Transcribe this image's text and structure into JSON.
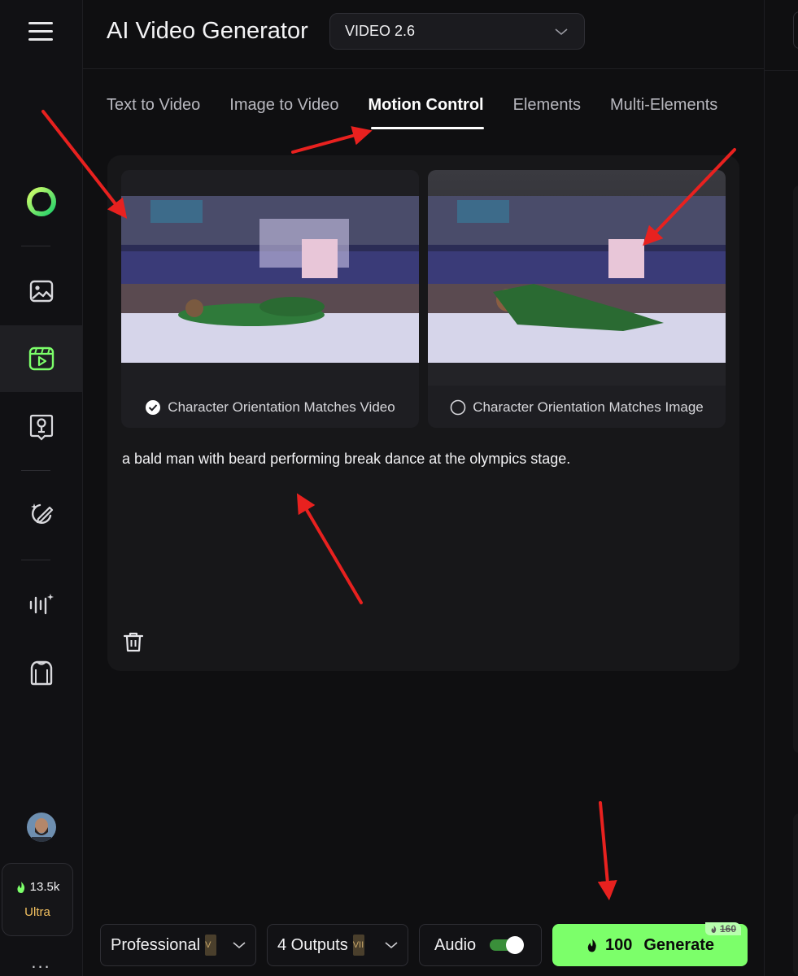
{
  "header": {
    "title": "AI Video Generator",
    "model_select_value": "VIDEO 2.6"
  },
  "tabs": [
    {
      "label": "Text to Video",
      "active": false
    },
    {
      "label": "Image to Video",
      "active": false
    },
    {
      "label": "Motion Control",
      "active": true
    },
    {
      "label": "Elements",
      "active": false
    },
    {
      "label": "Multi-Elements",
      "active": false
    }
  ],
  "sidebar": {
    "items": [
      {
        "icon": "image-icon",
        "active": false
      },
      {
        "icon": "video-icon",
        "active": true
      },
      {
        "icon": "lightbulb-icon",
        "active": false
      },
      {
        "icon": "magic-edit-icon",
        "active": false
      },
      {
        "icon": "audio-wave-icon",
        "active": false
      },
      {
        "icon": "shirt-icon",
        "active": false
      }
    ],
    "credits": "13.5k",
    "tier": "Ultra",
    "more": "..."
  },
  "motion_control": {
    "option_video_label": "Character Orientation Matches Video",
    "option_image_label": "Character Orientation Matches Image",
    "selected_option": "video",
    "prompt": "a bald man with beard performing break dance at the olympics stage."
  },
  "bottom_bar": {
    "quality": "Professional",
    "quality_badge": "V",
    "outputs": "4 Outputs",
    "outputs_badge": "VII",
    "audio_label": "Audio",
    "audio_on": true,
    "generate_cost": "100",
    "generate_label": "Generate",
    "original_cost": "160"
  },
  "colors": {
    "accent": "#7cff6a",
    "background": "#0f0f11",
    "panel": "#171719",
    "annotation": "#e8211f"
  }
}
